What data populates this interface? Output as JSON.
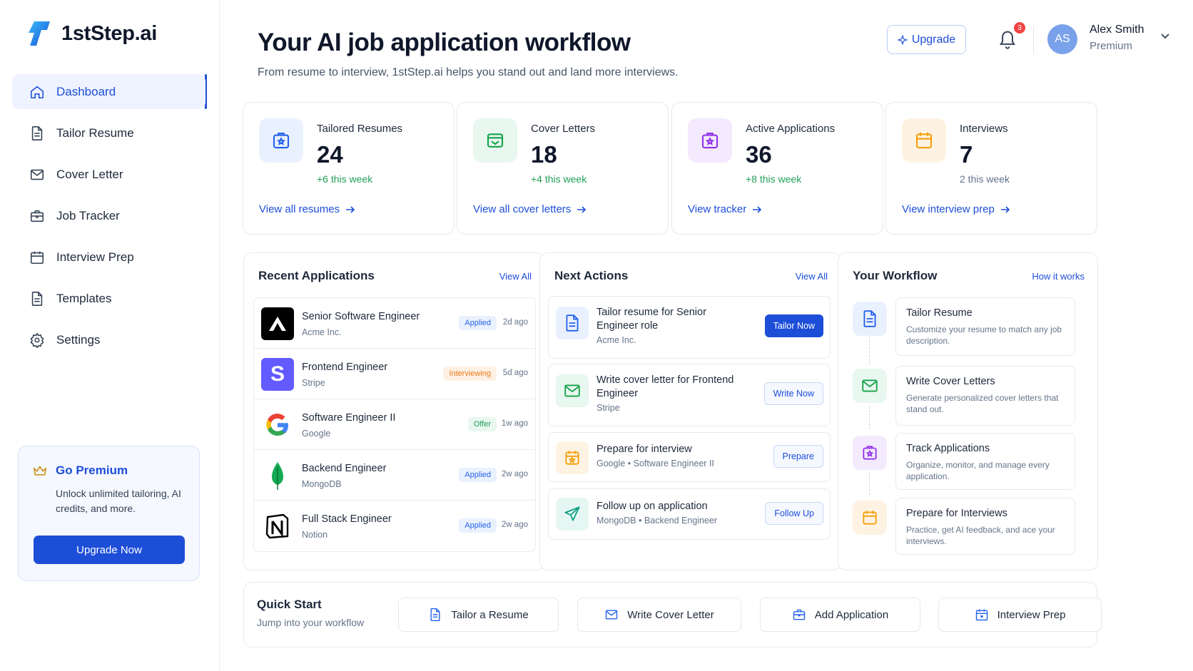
{
  "brand": {
    "name": "1stStep.ai"
  },
  "sidebar": {
    "items": [
      {
        "label": "Dashboard",
        "icon": "home-icon",
        "active": true
      },
      {
        "label": "Tailor Resume",
        "icon": "document-icon"
      },
      {
        "label": "Cover Letter",
        "icon": "mail-icon"
      },
      {
        "label": "Job Tracker",
        "icon": "briefcase-icon"
      },
      {
        "label": "Interview Prep",
        "icon": "calendar-icon"
      },
      {
        "label": "Templates",
        "icon": "document-icon"
      },
      {
        "label": "Settings",
        "icon": "gear-icon"
      }
    ]
  },
  "premium": {
    "title": "Go Premium",
    "text": "Unlock unlimited tailoring, AI credits, and more.",
    "button": "Upgrade Now"
  },
  "header": {
    "title": "Your AI job application workflow",
    "subtitle": "From resume to interview, 1stStep.ai helps you stand out and land more interviews.",
    "upgrade": "Upgrade",
    "notifications": "3",
    "user": {
      "initials": "AS",
      "name": "Alex Smith",
      "plan": "Premium"
    }
  },
  "stats": [
    {
      "label": "Tailored Resumes",
      "value": "24",
      "delta": "+6 this week",
      "link": "View all resumes",
      "color": "#2563eb",
      "bg": "#eaf1fe"
    },
    {
      "label": "Cover Letters",
      "value": "18",
      "delta": "+4 this week",
      "link": "View all cover letters",
      "color": "#16a34a",
      "bg": "#e8f7ef"
    },
    {
      "label": "Active Applications",
      "value": "36",
      "delta": "+8 this week",
      "link": "View tracker",
      "color": "#9333ea",
      "bg": "#f3eafd"
    },
    {
      "label": "Interviews",
      "value": "7",
      "delta": "2 this week",
      "link": "View interview prep",
      "color": "#f59e0b",
      "bg": "#fef3e2"
    }
  ],
  "recent": {
    "title": "Recent Applications",
    "link": "View All",
    "rows": [
      {
        "title": "Senior Software Engineer",
        "company": "Acme Inc.",
        "status": "Applied",
        "kind": "applied",
        "time": "2d ago"
      },
      {
        "title": "Frontend Engineer",
        "company": "Stripe",
        "status": "Interviewing",
        "kind": "interviewing",
        "time": "5d ago"
      },
      {
        "title": "Software Engineer II",
        "company": "Google",
        "status": "Offer",
        "kind": "offer",
        "time": "1w ago"
      },
      {
        "title": "Backend Engineer",
        "company": "MongoDB",
        "status": "Applied",
        "kind": "applied",
        "time": "2w ago"
      },
      {
        "title": "Full Stack Engineer",
        "company": "Notion",
        "status": "Applied",
        "kind": "applied",
        "time": "2w ago"
      }
    ]
  },
  "actions": {
    "title": "Next Actions",
    "link": "View All",
    "items": [
      {
        "title": "Tailor resume for Senior Engineer role",
        "sub": "Acme Inc.",
        "button": "Tailor Now"
      },
      {
        "title": "Write cover letter for Frontend Engineer",
        "sub": "Stripe",
        "button": "Write Now"
      },
      {
        "title": "Prepare for interview",
        "sub": "Google • Software Engineer II",
        "button": "Prepare"
      },
      {
        "title": "Follow up on application",
        "sub": "MongoDB • Backend Engineer",
        "button": "Follow Up"
      }
    ]
  },
  "workflow": {
    "title": "Your Workflow",
    "link": "How it works",
    "steps": [
      {
        "title": "Tailor Resume",
        "desc": "Customize your resume to match any job description."
      },
      {
        "title": "Write Cover Letters",
        "desc": "Generate personalized cover letters that stand out."
      },
      {
        "title": "Track Applications",
        "desc": "Organize, monitor, and manage every application."
      },
      {
        "title": "Prepare for Interviews",
        "desc": "Practice, get AI feedback, and ace your interviews."
      }
    ]
  },
  "quick": {
    "title": "Quick Start",
    "subtitle": "Jump into your workflow",
    "buttons": [
      "Tailor a Resume",
      "Write Cover Letter",
      "Add Application",
      "Interview Prep"
    ]
  }
}
